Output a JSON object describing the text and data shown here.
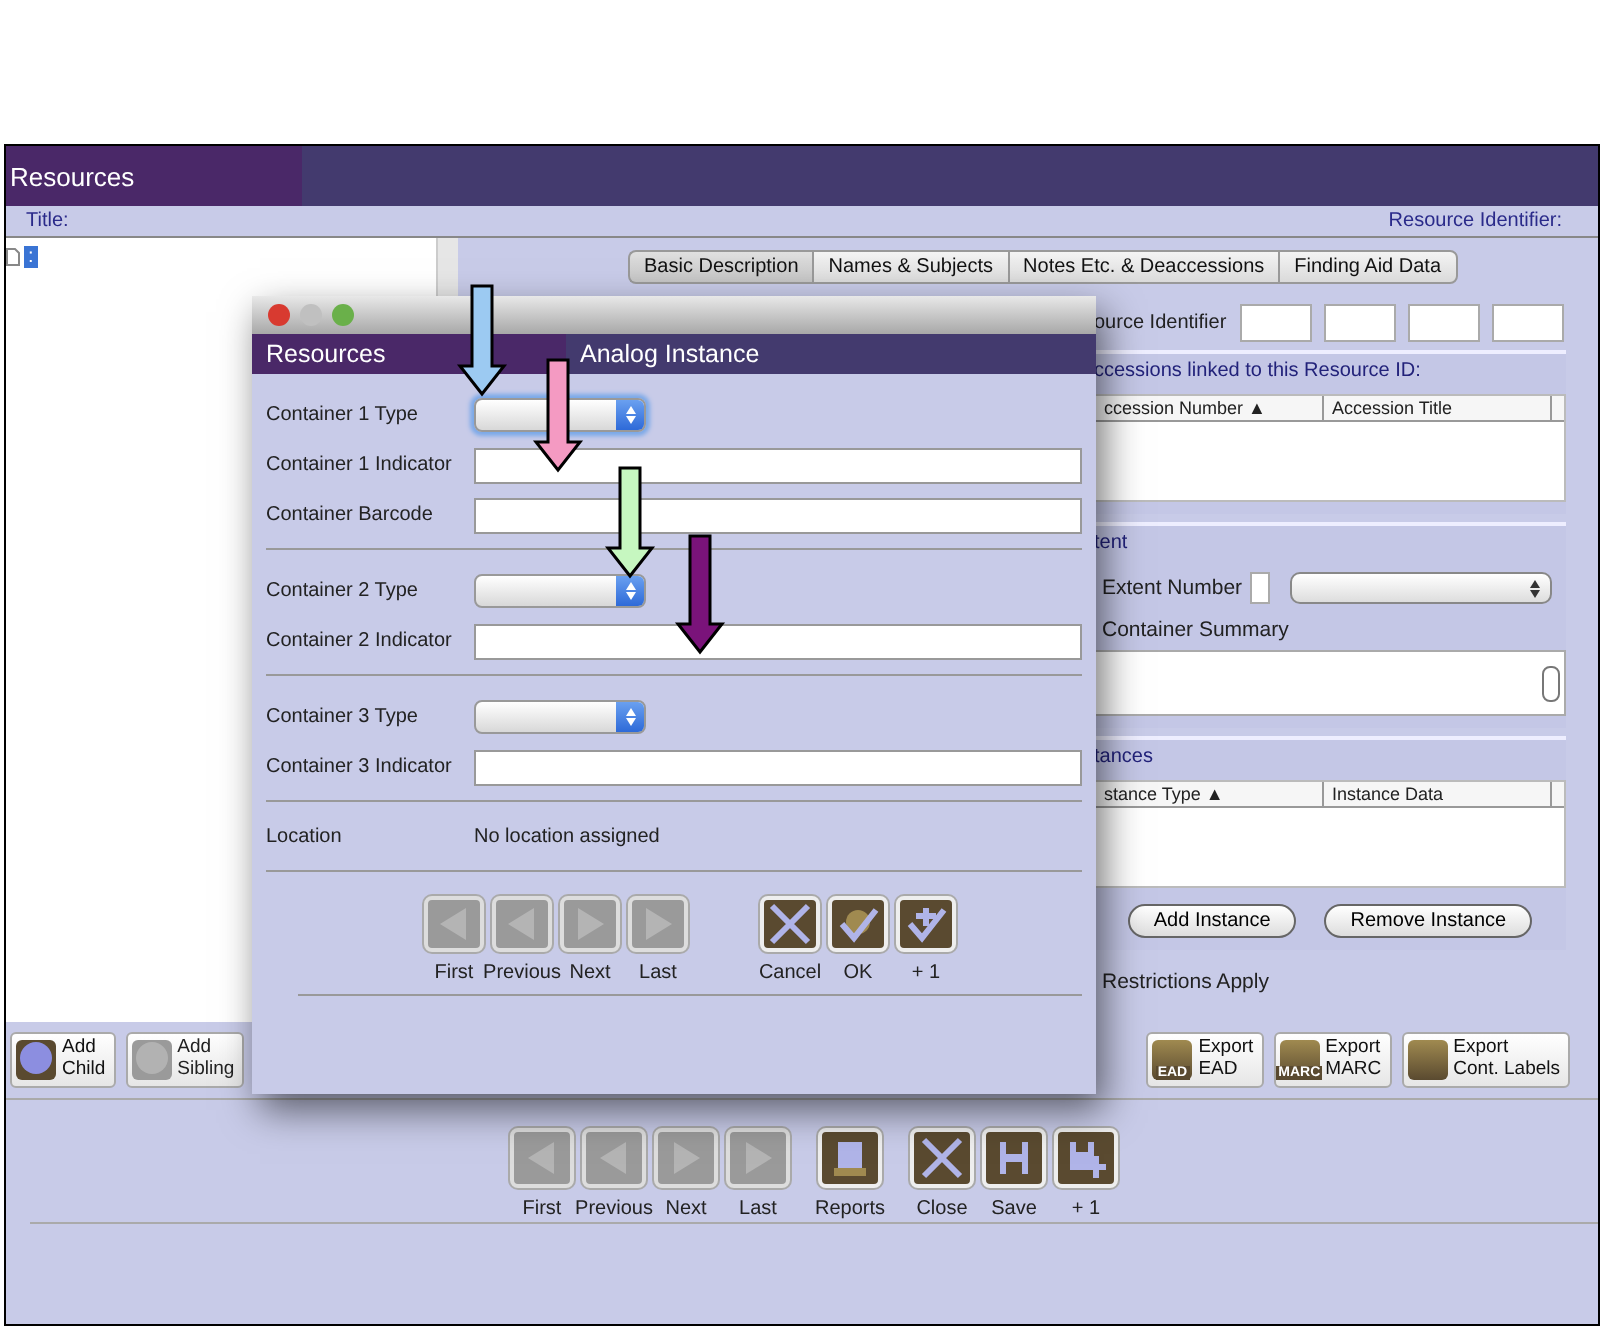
{
  "window": {
    "title": "Resources"
  },
  "record_header": {
    "title_label": "Title:",
    "identifier_label": "Resource Identifier:"
  },
  "tree": {
    "items": [
      {
        "label": ":",
        "selected": true
      }
    ]
  },
  "tabs": [
    {
      "label": "Basic Description",
      "selected": true
    },
    {
      "label": "Names & Subjects",
      "selected": false
    },
    {
      "label": "Notes Etc. & Deaccessions",
      "selected": false
    },
    {
      "label": "Finding Aid Data",
      "selected": false
    }
  ],
  "identifier": {
    "label": "ource Identifier"
  },
  "accessions": {
    "label": "ccessions linked to this Resource ID:",
    "columns": [
      "ccession Number ▲",
      "Accession Title"
    ]
  },
  "extent": {
    "label": "tent",
    "number_label": "Extent Number",
    "summary_label": "Container Summary"
  },
  "instances": {
    "label": "tances",
    "columns": [
      "stance Type ▲",
      "Instance Data"
    ],
    "buttons": [
      "Add Instance",
      "Remove Instance"
    ]
  },
  "restrictions": {
    "label": "Restrictions Apply"
  },
  "tree_buttons": [
    {
      "label": "Add\nChild",
      "disabled": false
    },
    {
      "label": "Add\nSibling",
      "disabled": true
    }
  ],
  "export_buttons": [
    {
      "label": "Export\nEAD",
      "icon_text": "EAD"
    },
    {
      "label": "Export\nMARC",
      "icon_text": "MARC"
    },
    {
      "label": "Export\nCont. Labels"
    }
  ],
  "nav_groups": [
    [
      {
        "label": "First",
        "kind": "first",
        "disabled": true
      },
      {
        "label": "Previous",
        "kind": "previous",
        "disabled": true
      },
      {
        "label": "Next",
        "kind": "next",
        "disabled": true
      },
      {
        "label": "Last",
        "kind": "last",
        "disabled": true
      }
    ],
    [
      {
        "label": "Reports",
        "kind": "reports",
        "disabled": false
      }
    ],
    [
      {
        "label": "Close",
        "kind": "cancel",
        "disabled": false
      },
      {
        "label": "Save",
        "kind": "save",
        "disabled": false
      },
      {
        "label": "+ 1",
        "kind": "saveplus",
        "disabled": false
      }
    ]
  ],
  "dialog": {
    "title_left": "Resources",
    "title": "Analog Instance",
    "sections": [
      {
        "rows": [
          {
            "label": "Container 1 Type",
            "kind": "select",
            "focused": true
          },
          {
            "label": "Container 1 Indicator",
            "kind": "text",
            "focused": false
          },
          {
            "label": "Container Barcode",
            "kind": "text",
            "focused": false
          }
        ]
      },
      {
        "rows": [
          {
            "label": "Container 2 Type",
            "kind": "select",
            "focused": false
          },
          {
            "label": "Container 2 Indicator",
            "kind": "text",
            "focused": false
          }
        ]
      },
      {
        "rows": [
          {
            "label": "Container 3 Type",
            "kind": "select",
            "focused": false
          },
          {
            "label": "Container 3 Indicator",
            "kind": "text",
            "focused": false
          }
        ]
      }
    ],
    "location": {
      "label": "Location",
      "value": "No location assigned"
    },
    "nav_groups": [
      [
        {
          "label": "First",
          "kind": "first",
          "disabled": true
        },
        {
          "label": "Previous",
          "kind": "previous",
          "disabled": true
        },
        {
          "label": "Next",
          "kind": "next",
          "disabled": true
        },
        {
          "label": "Last",
          "kind": "last",
          "disabled": true
        }
      ],
      [
        {
          "label": "Cancel",
          "kind": "cancel",
          "disabled": false
        },
        {
          "label": "OK",
          "kind": "ok",
          "disabled": false
        },
        {
          "label": "+ 1",
          "kind": "plus",
          "disabled": false
        }
      ]
    ]
  },
  "annotation_arrows": [
    {
      "color": "#9ccaf2"
    },
    {
      "color": "#f49ac2"
    },
    {
      "color": "#c6f7c0"
    },
    {
      "color": "#7a137a"
    }
  ]
}
